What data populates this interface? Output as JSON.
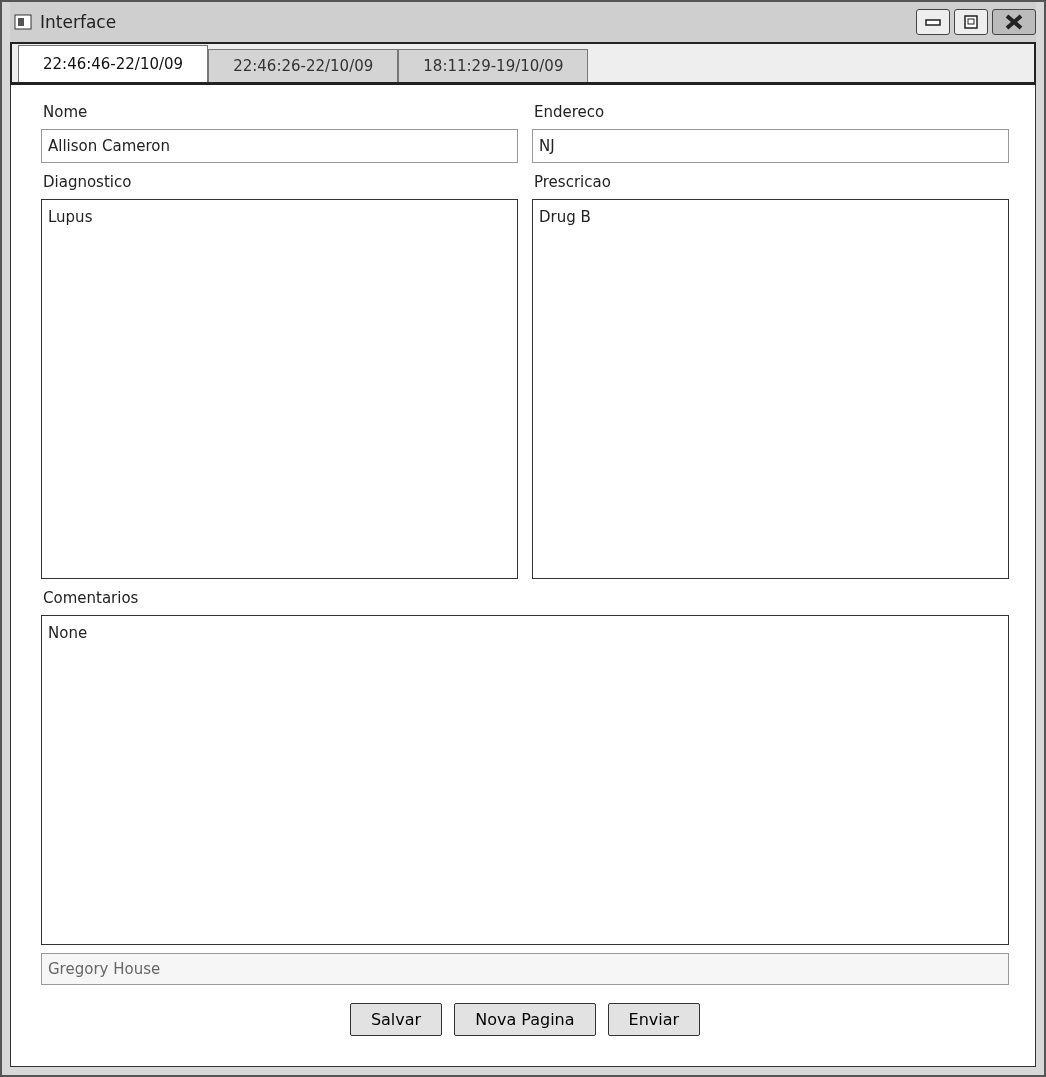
{
  "window": {
    "title": "Interface"
  },
  "tabs": [
    {
      "label": "22:46:46-22/10/09",
      "selected": true
    },
    {
      "label": "22:46:26-22/10/09",
      "selected": false
    },
    {
      "label": "18:11:29-19/10/09",
      "selected": false
    }
  ],
  "form": {
    "nome": {
      "label": "Nome",
      "value": "Allison Cameron"
    },
    "endereco": {
      "label": "Endereco",
      "value": "NJ"
    },
    "diagnostico": {
      "label": "Diagnostico",
      "value": "Lupus"
    },
    "prescricao": {
      "label": "Prescricao",
      "value": "Drug B"
    },
    "comentarios": {
      "label": "Comentarios",
      "value": "None"
    },
    "doctor": {
      "value": "Gregory House"
    }
  },
  "buttons": [
    "Salvar",
    "Nova Pagina",
    "Enviar"
  ]
}
